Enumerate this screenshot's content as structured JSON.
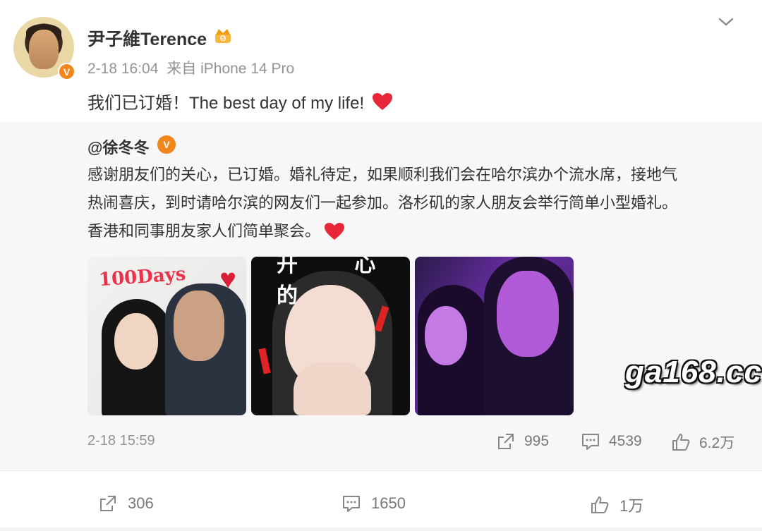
{
  "post": {
    "author": "尹子維Terence",
    "timestamp": "2-18 16:04",
    "source": "来自 iPhone 14 Pro",
    "text": "我们已订婚！The best day of my life!",
    "verified_icon": "verified-badge-icon",
    "member_icon": "crown-icon"
  },
  "repost": {
    "author": "@徐冬冬",
    "body_lines": [
      "感谢朋友们的关心，已订婚。婚礼待定，如果顺利我们会在哈尔滨办个流水席，接地气",
      "热闹喜庆，到时请哈尔滨的网友们一起参加。洛杉矶的家人朋友会举行简单小型婚礼。",
      "香港和同事朋友家人们简单聚会。"
    ],
    "photo_texts": {
      "photo1": "100Days",
      "photo2": "开 心 的"
    },
    "timestamp": "2-18 15:59",
    "stats": {
      "shares": "995",
      "comments": "4539",
      "likes": "6.2万"
    }
  },
  "actions": {
    "shares": "306",
    "comments": "1650",
    "likes": "1万"
  },
  "watermark": "ga168.cc",
  "colors": {
    "accent_orange": "#f0861c",
    "heart_red": "#e8263a",
    "muted_gray": "#939393",
    "repost_bg": "#f7f7f7"
  }
}
